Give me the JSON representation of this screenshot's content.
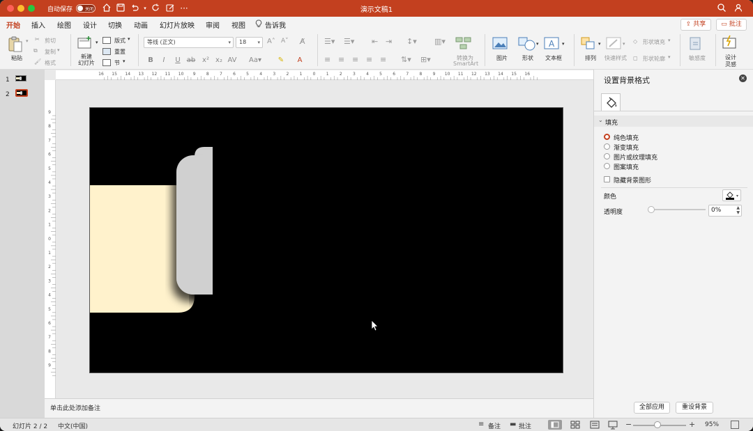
{
  "titlebar": {
    "autosave_label": "自动保存",
    "autosave_state": "关闭",
    "doc_title": "演示文稿1"
  },
  "tabs": [
    "开始",
    "插入",
    "绘图",
    "设计",
    "切换",
    "动画",
    "幻灯片放映",
    "审阅",
    "视图"
  ],
  "tell_me": "告诉我",
  "share_label": "共享",
  "comments_label": "批注",
  "ribbon": {
    "paste": "粘贴",
    "cut": "剪切",
    "copy": "复制",
    "format_painter": "格式",
    "new_slide": "新建\n幻灯片",
    "layout": "版式",
    "reset": "重置",
    "section": "节",
    "font_name": "等线 (正文)",
    "font_size": "18",
    "convert_smartart_1": "转换为",
    "convert_smartart_2": "SmartArt",
    "picture": "图片",
    "shapes": "形状",
    "textbox": "文本框",
    "arrange": "排列",
    "quick_styles": "快速样式",
    "shape_fill": "形状填充",
    "shape_outline": "形状轮廓",
    "sensitivity": "敏感度",
    "designer_1": "设计",
    "designer_2": "灵感"
  },
  "ruler_h_labels": [
    "16",
    "15",
    "14",
    "13",
    "12",
    "11",
    "10",
    "9",
    "8",
    "7",
    "6",
    "5",
    "4",
    "3",
    "2",
    "1",
    "0",
    "1",
    "2",
    "3",
    "4",
    "5",
    "6",
    "7",
    "8",
    "9",
    "10",
    "11",
    "12",
    "13",
    "14",
    "15",
    "16"
  ],
  "ruler_v_labels": [
    "9",
    "8",
    "7",
    "6",
    "5",
    "4",
    "3",
    "2",
    "1",
    "0",
    "1",
    "2",
    "3",
    "4",
    "5",
    "6",
    "7",
    "8",
    "9"
  ],
  "slides": [
    "1",
    "2"
  ],
  "notes_placeholder": "单击此处添加备注",
  "pane": {
    "title": "设置背景格式",
    "section_fill": "填充",
    "options": [
      "纯色填充",
      "渐变填充",
      "图片或纹理填充",
      "图案填充"
    ],
    "selected_option": 0,
    "hide_bg_graphics": "隐藏背景图形",
    "color_label": "颜色",
    "transparency_label": "透明度",
    "transparency_value": "0%",
    "transparency_fraction": 0,
    "apply_all": "全部应用",
    "reset_bg": "重设背景"
  },
  "status": {
    "slide_indicator": "幻灯片 2 / 2",
    "language": "中文(中国)",
    "notes": "备注",
    "comments": "批注",
    "zoom": "95%"
  },
  "colors": {
    "accent": "#c3401f",
    "cream": "#fff2cc",
    "tab_gray": "#d0d0d0",
    "slide_bg": "#000000"
  },
  "icons": {
    "search": "search-icon",
    "profile": "profile-icon",
    "home": "home-icon",
    "save": "save-icon",
    "undo": "undo-icon",
    "redo": "redo-icon",
    "paint_bucket": "paint-bucket-icon"
  }
}
